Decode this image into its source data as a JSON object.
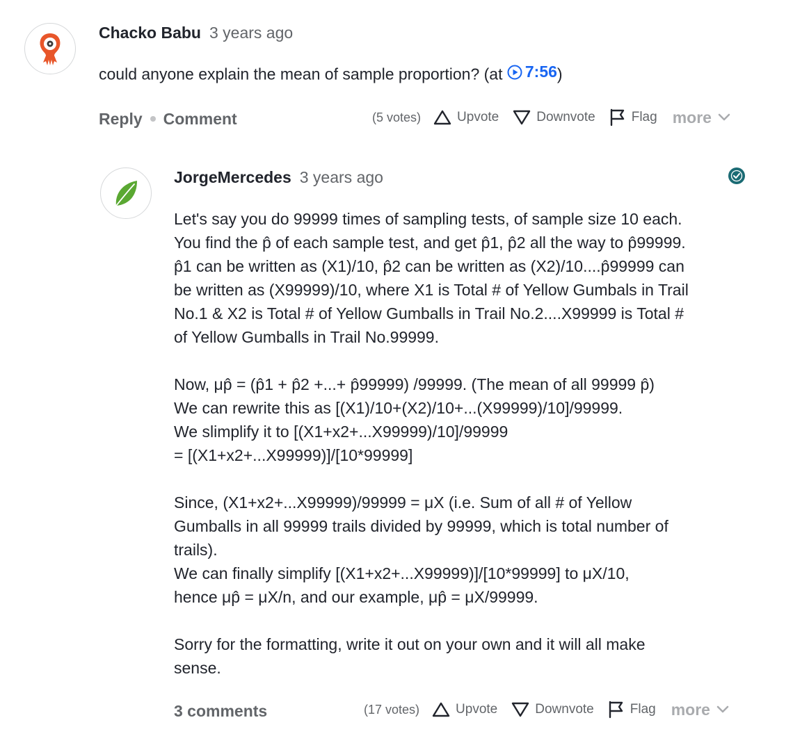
{
  "question": {
    "author": "Chacko Babu",
    "time": "3 years ago",
    "text_before": "could anyone explain the mean of sample proportion? (at ",
    "timestamp_link": "7:56",
    "text_after": ")",
    "reply_label": "Reply",
    "comment_label": "Comment",
    "votes": "(5 votes)",
    "upvote_label": "Upvote",
    "downvote_label": "Downvote",
    "flag_label": "Flag",
    "more_label": "more"
  },
  "answer": {
    "author": "JorgeMercedes",
    "time": "3 years ago",
    "paragraphs": [
      [
        "Let's say you do 99999 times of sampling tests, of sample size 10 each.",
        "You find the p̂ of each sample test, and get p̂1, p̂2 all the way to p̂99999.",
        "p̂1 can be written as (X1)/10, p̂2 can be written as (X2)/10....p̂99999 can",
        "be written as (X99999)/10, where X1 is Total # of Yellow Gumbals in Trail",
        "No.1 & X2 is Total # of Yellow Gumballs in Trail No.2....X99999 is Total #",
        "of Yellow Gumballs in Trail No.99999."
      ],
      [
        "Now, μp̂ = (p̂1 + p̂2 +...+ p̂99999) /99999. (The mean of all 99999 p̂)",
        "We can rewrite this as [(X1)/10+(X2)/10+...(X99999)/10]/99999.",
        "We slimplify it to [(X1+x2+...X99999)/10]/99999",
        "= [(X1+x2+...X99999)]/[10*99999]"
      ],
      [
        "Since, (X1+x2+...X99999)/99999 = μX (i.e. Sum of all # of Yellow",
        "Gumballs in all 99999 trails divided by 99999, which is total number of",
        "trails).",
        "We can finally simplify [(X1+x2+...X99999)]/[10*99999] to μX/10,",
        "hence μp̂ = μX/n, and our example, μp̂ = μX/99999."
      ],
      [
        "Sorry for the formatting, write it out on your own and it will all make",
        "sense."
      ]
    ],
    "comments_label": "3 comments",
    "votes": "(17 votes)",
    "upvote_label": "Upvote",
    "downvote_label": "Downvote",
    "flag_label": "Flag",
    "more_label": "more"
  },
  "colors": {
    "link_blue": "#1865f2",
    "gray_text": "#626569",
    "accent_teal": "#1b6b74",
    "leaf_green": "#5aa832",
    "avatar_orange": "#e8562a"
  },
  "icons": [
    "play-circle-icon",
    "upvote-icon",
    "downvote-icon",
    "flag-icon",
    "chevron-down-icon",
    "verified-badge-icon",
    "leaf-avatar-icon",
    "creature-avatar-icon"
  ]
}
